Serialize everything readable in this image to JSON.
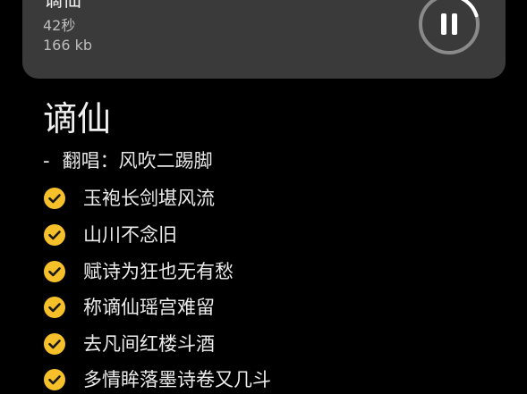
{
  "player": {
    "title": "谪仙",
    "duration": "42秒",
    "size": "166 kb",
    "control_icon": "pause-icon",
    "progress_fraction": 0.2
  },
  "song": {
    "title": "谪仙",
    "artist_dash": "-",
    "artist_line": "翻唱：风吹二踢脚"
  },
  "lyrics": [
    {
      "text": "玉袍长剑堪风流",
      "icon": "check-circle-icon"
    },
    {
      "text": "山川不念旧",
      "icon": "check-circle-icon"
    },
    {
      "text": "赋诗为狂也无有愁",
      "icon": "check-circle-icon"
    },
    {
      "text": "称谪仙瑶宫难留",
      "icon": "check-circle-icon"
    },
    {
      "text": "去凡间红楼斗酒",
      "icon": "check-circle-icon"
    },
    {
      "text": "多情眸落墨诗卷又几斗",
      "icon": "check-circle-icon"
    }
  ],
  "colors": {
    "background": "#000000",
    "card": "#3a3a3a",
    "check": "#f6c02b",
    "text": "#ececec"
  }
}
